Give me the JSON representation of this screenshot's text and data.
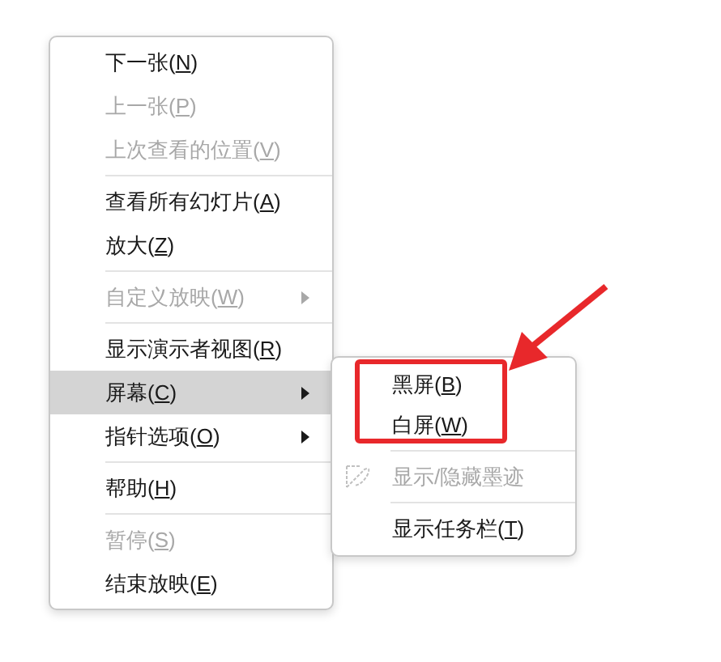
{
  "context_menu": {
    "items": [
      {
        "prefix": "下一张(",
        "key": "N",
        "suffix": ")",
        "disabled": false,
        "submenu": false,
        "selected": false,
        "separator_after": false
      },
      {
        "prefix": "上一张(",
        "key": "P",
        "suffix": ")",
        "disabled": true,
        "submenu": false,
        "selected": false,
        "separator_after": false
      },
      {
        "prefix": "上次查看的位置(",
        "key": "V",
        "suffix": ")",
        "disabled": true,
        "submenu": false,
        "selected": false,
        "separator_after": true
      },
      {
        "prefix": "查看所有幻灯片(",
        "key": "A",
        "suffix": ")",
        "disabled": false,
        "submenu": false,
        "selected": false,
        "separator_after": false
      },
      {
        "prefix": "放大(",
        "key": "Z",
        "suffix": ")",
        "disabled": false,
        "submenu": false,
        "selected": false,
        "separator_after": true
      },
      {
        "prefix": "自定义放映(",
        "key": "W",
        "suffix": ")",
        "disabled": true,
        "submenu": true,
        "selected": false,
        "separator_after": true
      },
      {
        "prefix": "显示演示者视图(",
        "key": "R",
        "suffix": ")",
        "disabled": false,
        "submenu": false,
        "selected": false,
        "separator_after": false
      },
      {
        "prefix": "屏幕(",
        "key": "C",
        "suffix": ")",
        "disabled": false,
        "submenu": true,
        "selected": true,
        "separator_after": false
      },
      {
        "prefix": "指针选项(",
        "key": "O",
        "suffix": ")",
        "disabled": false,
        "submenu": true,
        "selected": false,
        "separator_after": true
      },
      {
        "prefix": "帮助(",
        "key": "H",
        "suffix": ")",
        "disabled": false,
        "submenu": false,
        "selected": false,
        "separator_after": true
      },
      {
        "prefix": "暂停(",
        "key": "S",
        "suffix": ")",
        "disabled": true,
        "submenu": false,
        "selected": false,
        "separator_after": false
      },
      {
        "prefix": "结束放映(",
        "key": "E",
        "suffix": ")",
        "disabled": false,
        "submenu": false,
        "selected": false,
        "separator_after": false
      }
    ]
  },
  "submenu": {
    "items": [
      {
        "prefix": "黑屏(",
        "key": "B",
        "suffix": ")",
        "disabled": false,
        "icon": false,
        "highlighted": true,
        "separator_after": false
      },
      {
        "prefix": "白屏(",
        "key": "W",
        "suffix": ")",
        "disabled": false,
        "icon": false,
        "highlighted": true,
        "separator_after": true
      },
      {
        "prefix": "显示/隐藏墨迹",
        "disabled": true,
        "icon": true,
        "highlighted": false,
        "separator_after": true
      },
      {
        "prefix": "显示任务栏(",
        "key": "T",
        "suffix": ")",
        "disabled": false,
        "icon": false,
        "highlighted": false,
        "separator_after": false
      }
    ]
  }
}
